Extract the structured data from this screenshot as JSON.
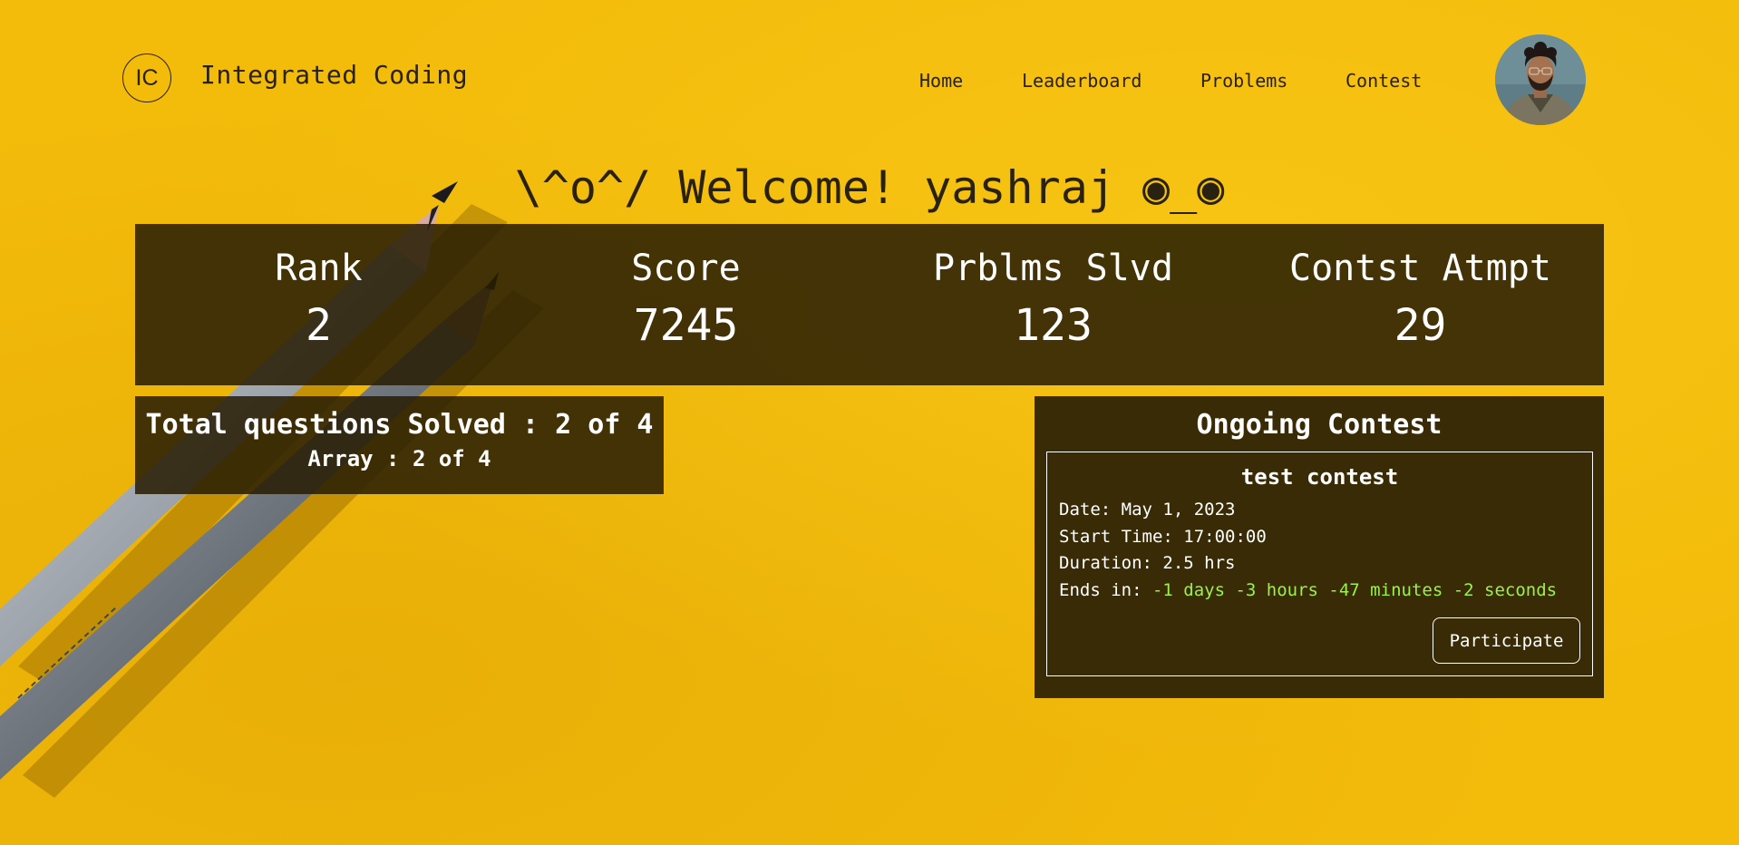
{
  "navbar": {
    "logo_text": "IC",
    "brand": "Integrated Coding",
    "links": [
      "Home",
      "Leaderboard",
      "Problems",
      "Contest"
    ]
  },
  "welcome": {
    "text": "\\^o^/ Welcome! yashraj ◉_◉"
  },
  "stats": [
    {
      "label": "Rank",
      "value": "2"
    },
    {
      "label": "Score",
      "value": "7245"
    },
    {
      "label": "Prblms Slvd",
      "value": "123"
    },
    {
      "label": "Contst Atmpt",
      "value": "29"
    }
  ],
  "solved": {
    "title": "Total questions Solved : 2 of 4",
    "subtitle": "Array : 2 of 4"
  },
  "contest": {
    "heading": "Ongoing Contest",
    "name": "test contest",
    "date_label": "Date:",
    "date": "May 1, 2023",
    "start_label": "Start Time:",
    "start": "17:00:00",
    "duration_label": "Duration:",
    "duration": "2.5 hrs",
    "ends_label": "Ends in:",
    "ends": "-1 days -3 hours -47 minutes -2 seconds",
    "button": "Participate"
  },
  "colors": {
    "background": "#f3bb0a",
    "panel": "#281e05",
    "countdown": "#9cf24a"
  }
}
